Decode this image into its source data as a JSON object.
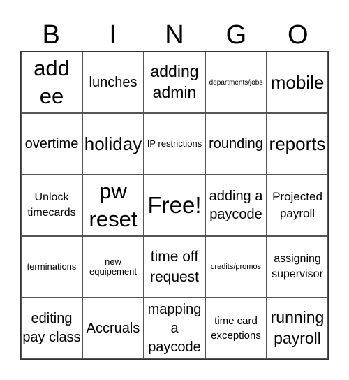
{
  "header": [
    "B",
    "I",
    "N",
    "G",
    "O"
  ],
  "cells": [
    [
      "add ee",
      "lunches",
      "adding admin",
      "departments/jobs",
      "mobile"
    ],
    [
      "overtime",
      "holiday",
      "IP restrictions",
      "rounding",
      "reports"
    ],
    [
      "Unlock timecards",
      "pw reset",
      "Free!",
      "adding a paycode",
      "Projected payroll"
    ],
    [
      "terminations",
      "new equipement",
      "time off request",
      "credits/promos",
      "assigning supervisor"
    ],
    [
      "editing pay class",
      "Accruals",
      "mapping a paycode",
      "time card exceptions",
      "running payroll"
    ]
  ]
}
